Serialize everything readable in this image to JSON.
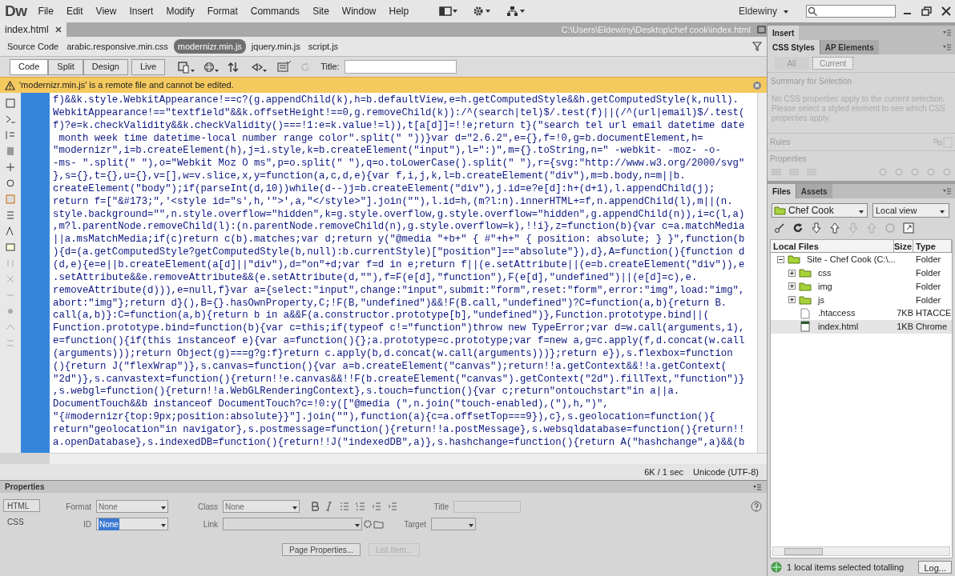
{
  "app": {
    "logo": "Dw",
    "menu": [
      "File",
      "Edit",
      "View",
      "Insert",
      "Modify",
      "Format",
      "Commands",
      "Site",
      "Window",
      "Help"
    ],
    "user": "Eldewiny"
  },
  "document": {
    "tab": "index.html",
    "path": "C:\\Users\\Eldewiny\\Desktop\\chef cook\\index.html",
    "related_files": [
      {
        "label": "Source Code",
        "selected": false
      },
      {
        "label": "arabic.responsive.min.css",
        "selected": false
      },
      {
        "label": "modernizr.min.js",
        "selected": true
      },
      {
        "label": "jquery.min.js",
        "selected": false
      },
      {
        "label": "script.js",
        "selected": false
      }
    ],
    "view_buttons": [
      {
        "label": "Code",
        "selected": true
      },
      {
        "label": "Split",
        "selected": false
      },
      {
        "label": "Design",
        "selected": false
      },
      {
        "label": "Live",
        "selected": false
      }
    ],
    "title_label": "Title:",
    "warning": "'modernizr.min.js' is a remote file and cannot be edited.",
    "code_lines": [
      "f)&&k.style.WebkitAppearance!==c?(g.appendChild(k),h=b.defaultView,e=h.getComputedStyle&&h.getComputedStyle(k,null).",
      "WebkitAppearance!==\"textfield\"&&k.offsetHeight!==0,g.removeChild(k)):/^(search|tel)$/.test(f)||(/^(url|email)$/.test(",
      "f)?e=k.checkValidity&&k.checkValidity()===!1:e=k.value!=l)),t[a[d]]=!!e;return t}(\"search tel url email datetime date",
      " month week time datetime-local number range color\".split(\" \"))}var d=\"2.6.2\",e={},f=!0,g=b.documentElement,h=",
      "\"modernizr\",i=b.createElement(h),j=i.style,k=b.createElement(\"input\"),l=\":)\",m={}.toString,n=\" -webkit- -moz- -o-",
      "-ms- \".split(\" \"),o=\"Webkit Moz O ms\",p=o.split(\" \"),q=o.toLowerCase().split(\" \"),r={svg:\"http://www.w3.org/2000/svg\"",
      "},s={},t={},u={},v=[],w=v.slice,x,y=function(a,c,d,e){var f,i,j,k,l=b.createElement(\"div\"),m=b.body,n=m||b.",
      "createElement(\"body\");if(parseInt(d,10))while(d--)j=b.createElement(\"div\"),j.id=e?e[d]:h+(d+1),l.appendChild(j);",
      "return f=[\"&#173;\",'<style id=\"s',h,'\">',a,\"</style>\"].join(\"\"),l.id=h,(m?l:n).innerHTML+=f,n.appendChild(l),m||(n.",
      "style.background=\"\",n.style.overflow=\"hidden\",k=g.style.overflow,g.style.overflow=\"hidden\",g.appendChild(n)),i=c(l,a)",
      ",m?l.parentNode.removeChild(l):(n.parentNode.removeChild(n),g.style.overflow=k),!!i},z=function(b){var c=a.matchMedia",
      "||a.msMatchMedia;if(c)return c(b).matches;var d;return y(\"@media \"+b+\" { #\"+h+\" { position: absolute; } }\",function(b",
      "){d=(a.getComputedStyle?getComputedStyle(b,null):b.currentStyle)[\"position\"]==\"absolute\"}),d},A=function(){function d",
      "(d,e){e=e||b.createElement(a[d]||\"div\"),d=\"on\"+d;var f=d in e;return f||(e.setAttribute||(e=b.createElement(\"div\")),e",
      ".setAttribute&&e.removeAttribute&&(e.setAttribute(d,\"\"),f=F(e[d],\"function\"),F(e[d],\"undefined\")||(e[d]=c),e.",
      "removeAttribute(d))),e=null,f}var a={select:\"input\",change:\"input\",submit:\"form\",reset:\"form\",error:\"img\",load:\"img\",",
      "abort:\"img\"};return d}(),B={}.hasOwnProperty,C;!F(B,\"undefined\")&&!F(B.call,\"undefined\")?C=function(a,b){return B.",
      "call(a,b)}:C=function(a,b){return b in a&&F(a.constructor.prototype[b],\"undefined\")},Function.prototype.bind||(",
      "Function.prototype.bind=function(b){var c=this;if(typeof c!=\"function\")throw new TypeError;var d=w.call(arguments,1),",
      "e=function(){if(this instanceof e){var a=function(){};a.prototype=c.prototype;var f=new a,g=c.apply(f,d.concat(w.call",
      "(arguments)));return Object(g)===g?g:f}return c.apply(b,d.concat(w.call(arguments)))};return e}),s.flexbox=function",
      "(){return J(\"flexWrap\")},s.canvas=function(){var a=b.createElement(\"canvas\");return!!a.getContext&&!!a.getContext(",
      "\"2d\")},s.canvastext=function(){return!!e.canvas&&!!F(b.createElement(\"canvas\").getContext(\"2d\").fillText,\"function\")}",
      ",s.webgl=function(){return!!a.WebGLRenderingContext},s.touch=function(){var c;return\"ontouchstart\"in a||a.",
      "DocumentTouch&&b instanceof DocumentTouch?c=!0:y([\"@media (\",n.join(\"touch-enabled),(\"),h,\")\",",
      "\"{#modernizr{top:9px;position:absolute}}\"].join(\"\"),function(a){c=a.offsetTop===9}),c},s.geolocation=function(){",
      "return\"geolocation\"in navigator},s.postmessage=function(){return!!a.postMessage},s.websqldatabase=function(){return!!",
      "a.openDatabase},s.indexedDB=function(){return!!J(\"indexedDB\",a)},s.hashchange=function(){return A(\"hashchange\",a)&&(b"
    ],
    "status": [
      "6K / 1 sec",
      "Unicode (UTF-8)"
    ]
  },
  "properties": {
    "title": "Properties",
    "modes": [
      {
        "label": "HTML",
        "selected": true
      },
      {
        "label": "CSS",
        "selected": false
      }
    ],
    "format": {
      "label": "Format",
      "value": "None"
    },
    "class": {
      "label": "Class",
      "value": "None"
    },
    "title_field": {
      "label": "Title"
    },
    "id": {
      "label": "ID",
      "value": "None"
    },
    "link": {
      "label": "Link"
    },
    "target": {
      "label": "Target"
    },
    "buttons": [
      {
        "label": "Page Properties...",
        "disabled": false
      },
      {
        "label": "List Item...",
        "disabled": true
      }
    ]
  },
  "panels": {
    "insert": "Insert",
    "css_tabs": [
      {
        "label": "CSS Styles",
        "selected": true
      },
      {
        "label": "AP Elements",
        "selected": false
      }
    ],
    "css_modes": [
      {
        "label": "All",
        "selected": false
      },
      {
        "label": "Current",
        "selected": true
      }
    ],
    "summary_heading": "Summary for Selection",
    "summary_text": "No CSS properties apply to the current selection.  Please select a styled element to see which CSS properties apply.",
    "rules": "Rules",
    "properties": "Properties",
    "file_tabs": [
      {
        "label": "Files",
        "selected": true
      },
      {
        "label": "Assets",
        "selected": false
      }
    ],
    "site": "Chef Cook",
    "view": "Local view",
    "columns": [
      "Local Files",
      "Size",
      "Type"
    ],
    "tree": [
      {
        "kind": "folder",
        "name": "Site - Chef Cook (C:\\...",
        "type": "Folder",
        "expanded": true,
        "selected": false,
        "children": [
          {
            "kind": "folder",
            "name": "css",
            "type": "Folder",
            "expanded": false,
            "selected": false
          },
          {
            "kind": "folder",
            "name": "img",
            "type": "Folder",
            "expanded": false,
            "selected": false
          },
          {
            "kind": "folder",
            "name": "js",
            "type": "Folder",
            "expanded": false,
            "selected": false
          },
          {
            "kind": "file",
            "name": ".htaccess",
            "size": "7KB",
            "type": "HTACCE",
            "selected": false
          },
          {
            "kind": "page",
            "name": "index.html",
            "size": "1KB",
            "type": "Chrome",
            "selected": true
          }
        ]
      }
    ],
    "files_status": "1 local items selected totalling",
    "log_button": "Log..."
  }
}
